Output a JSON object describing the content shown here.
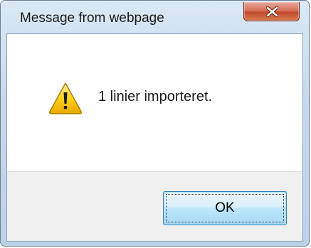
{
  "dialog": {
    "title": "Message from webpage",
    "message": "1 linier importeret.",
    "ok_label": "OK",
    "close_icon": "close-icon",
    "message_icon": "warning-icon"
  },
  "colors": {
    "close_button": "#c7472a",
    "ok_border": "#3c7fb1",
    "footer_bg": "#f0f0f0",
    "warning_fill": "#f5c400"
  }
}
